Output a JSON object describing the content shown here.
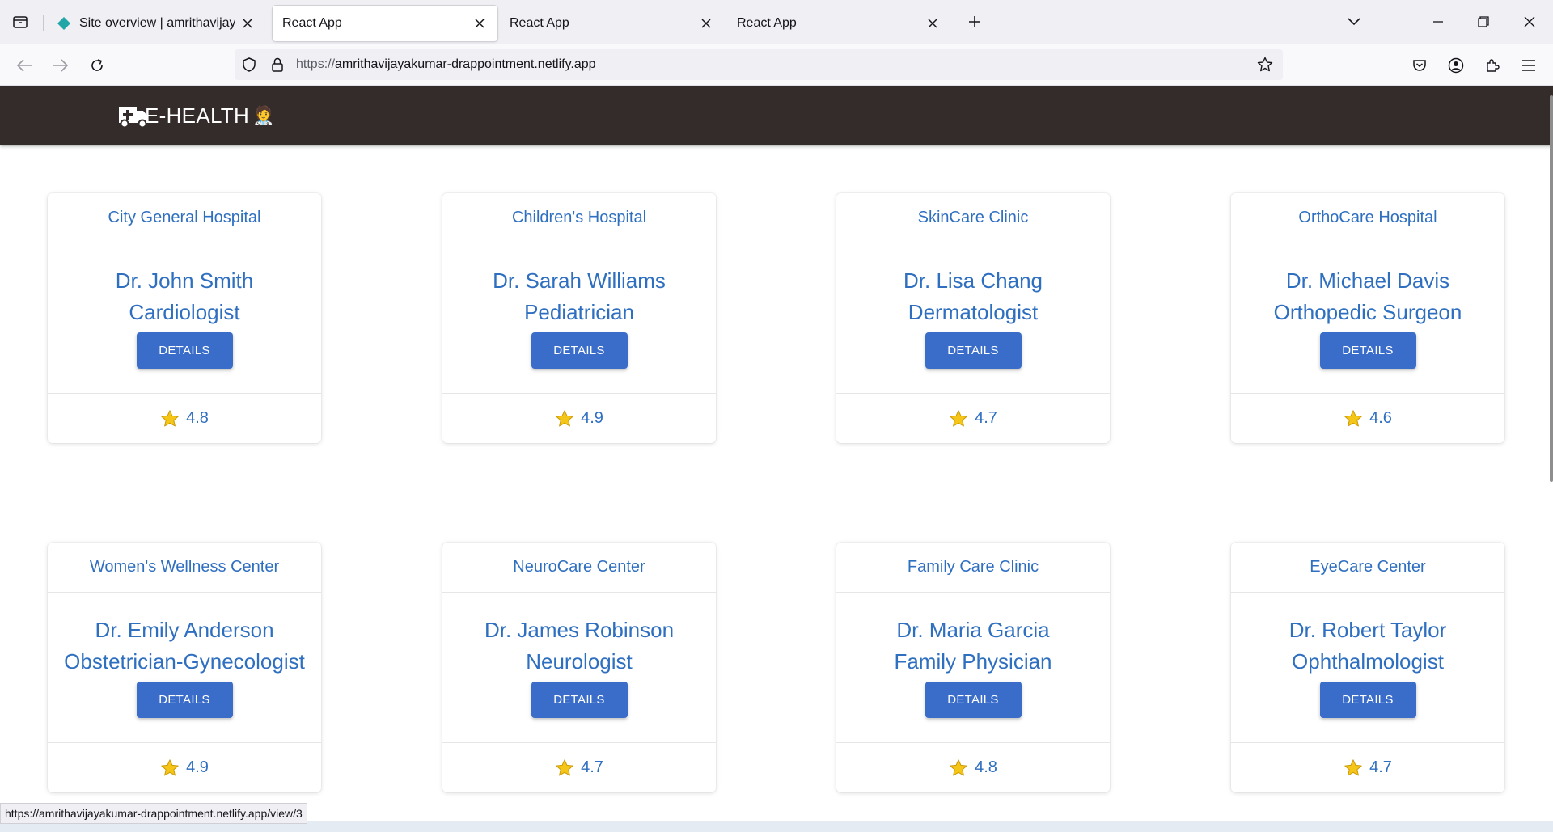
{
  "browser": {
    "tabs": [
      {
        "title": "Site overview | amrithavijayakumar",
        "active": false
      },
      {
        "title": "React App",
        "active": true
      },
      {
        "title": "React App",
        "active": false
      },
      {
        "title": "React App",
        "active": false
      }
    ],
    "url_protocol": "https://",
    "url_host": "amrithavijayakumar-drappointment.netlify.app",
    "status_url": "https://amrithavijayakumar-drappointment.netlify.app/view/3"
  },
  "header": {
    "brand": "E-HEALTH",
    "brand_emoji": "🧑‍⚕️"
  },
  "details_label": "DETAILS",
  "doctors": [
    {
      "hospital": "City General Hospital",
      "name": "Dr. John Smith",
      "specialty": "Cardiologist",
      "rating": "4.8"
    },
    {
      "hospital": "Children's Hospital",
      "name": "Dr. Sarah Williams",
      "specialty": "Pediatrician",
      "rating": "4.9"
    },
    {
      "hospital": "SkinCare Clinic",
      "name": "Dr. Lisa Chang",
      "specialty": "Dermatologist",
      "rating": "4.7"
    },
    {
      "hospital": "OrthoCare Hospital",
      "name": "Dr. Michael Davis",
      "specialty": "Orthopedic Surgeon",
      "rating": "4.6"
    },
    {
      "hospital": "Women's Wellness Center",
      "name": "Dr. Emily Anderson",
      "specialty": "Obstetrician-Gynecologist",
      "rating": "4.9"
    },
    {
      "hospital": "NeuroCare Center",
      "name": "Dr. James Robinson",
      "specialty": "Neurologist",
      "rating": "4.7"
    },
    {
      "hospital": "Family Care Clinic",
      "name": "Dr. Maria Garcia",
      "specialty": "Family Physician",
      "rating": "4.8"
    },
    {
      "hospital": "EyeCare Center",
      "name": "Dr. Robert Taylor",
      "specialty": "Ophthalmologist",
      "rating": "4.7"
    }
  ],
  "colors": {
    "header_bg": "#342c2a",
    "accent": "#2f6fc0",
    "button": "#3a6dc9",
    "star": "#f5c518"
  }
}
